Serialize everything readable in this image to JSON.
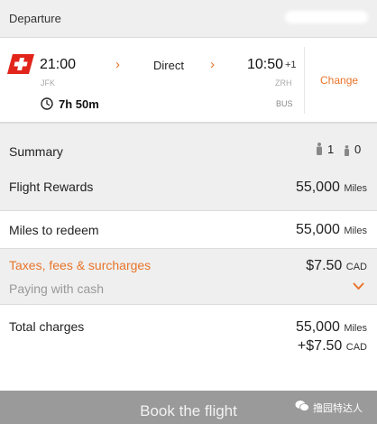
{
  "header": {
    "title": "Departure"
  },
  "flight": {
    "departure_time": "21:00",
    "arrival_time": "10:50",
    "day_offset": "+1",
    "stops": "Direct",
    "origin_code": "JFK",
    "destination_code": "ZRH",
    "duration": "7h 50m",
    "equipment": "BUS",
    "change_label": "Change",
    "arrow_glyph": "›",
    "airline_logo": "swiss-flag-logo",
    "brand_color": "#e1251b"
  },
  "summary": {
    "title": "Summary",
    "adults": "1",
    "children": "0"
  },
  "rewards": {
    "title": "Flight Rewards",
    "value": "55,000",
    "unit": "Miles"
  },
  "redeem": {
    "title": "Miles to redeem",
    "value": "55,000",
    "unit": "Miles"
  },
  "taxes": {
    "title": "Taxes, fees & surcharges",
    "value": "$7.50",
    "currency": "CAD",
    "subtitle": "Paying with cash"
  },
  "total": {
    "title": "Total charges",
    "miles_value": "55,000",
    "miles_unit": "Miles",
    "cash_value": "+$7.50",
    "cash_currency": "CAD"
  },
  "book_button": {
    "label": "Book the flight"
  },
  "watermark": {
    "text": "撸园特达人"
  },
  "colors": {
    "accent": "#e8742a",
    "panel_bg": "#efefef",
    "button_bg": "#9a9a9a"
  }
}
